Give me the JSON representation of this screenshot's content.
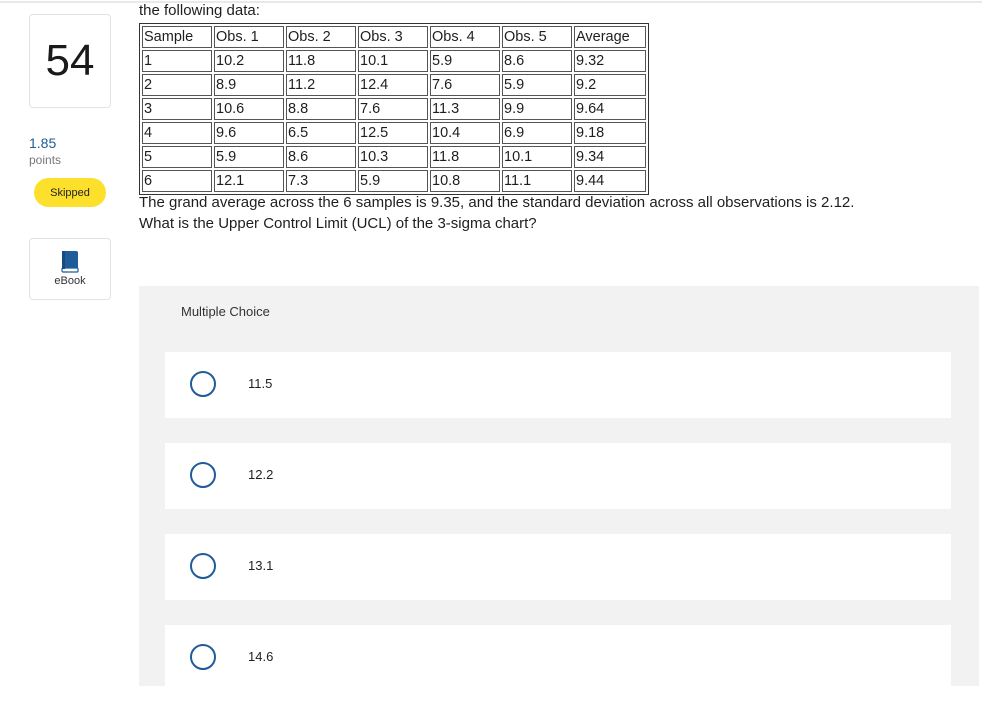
{
  "question": {
    "number": "54",
    "points_value": "1.85",
    "points_label": "points",
    "status": "Skipped",
    "ebook_label": "eBook",
    "intro": "the following data:",
    "table": {
      "headers": [
        "Sample",
        "Obs. 1",
        "Obs. 2",
        "Obs. 3",
        "Obs. 4",
        "Obs. 5",
        "Average"
      ],
      "rows": [
        [
          "1",
          "10.2",
          "11.8",
          "10.1",
          "5.9",
          "8.6",
          "9.32"
        ],
        [
          "2",
          "8.9",
          "11.2",
          "12.4",
          "7.6",
          "5.9",
          "9.2"
        ],
        [
          "3",
          "10.6",
          "8.8",
          "7.6",
          "11.3",
          "9.9",
          "9.64"
        ],
        [
          "4",
          "9.6",
          "6.5",
          "12.5",
          "10.4",
          "6.9",
          "9.18"
        ],
        [
          "5",
          "5.9",
          "8.6",
          "10.3",
          "11.8",
          "10.1",
          "9.34"
        ],
        [
          "6",
          "12.1",
          "7.3",
          "5.9",
          "10.8",
          "11.1",
          "9.44"
        ]
      ]
    },
    "statement": "The grand average across the 6 samples is 9.35, and the standard deviation across all observations is 2.12.",
    "ask": "What is the Upper Control Limit (UCL) of the 3-sigma chart?"
  },
  "multiple_choice": {
    "title": "Multiple Choice",
    "options": [
      "11.5",
      "12.2",
      "13.1",
      "14.6"
    ]
  },
  "colors": {
    "accent": "#1f5c99",
    "badge": "#fde02b",
    "panel": "#f2f2f2"
  },
  "icons": {
    "ebook": "book-icon",
    "option": "radio-icon"
  }
}
